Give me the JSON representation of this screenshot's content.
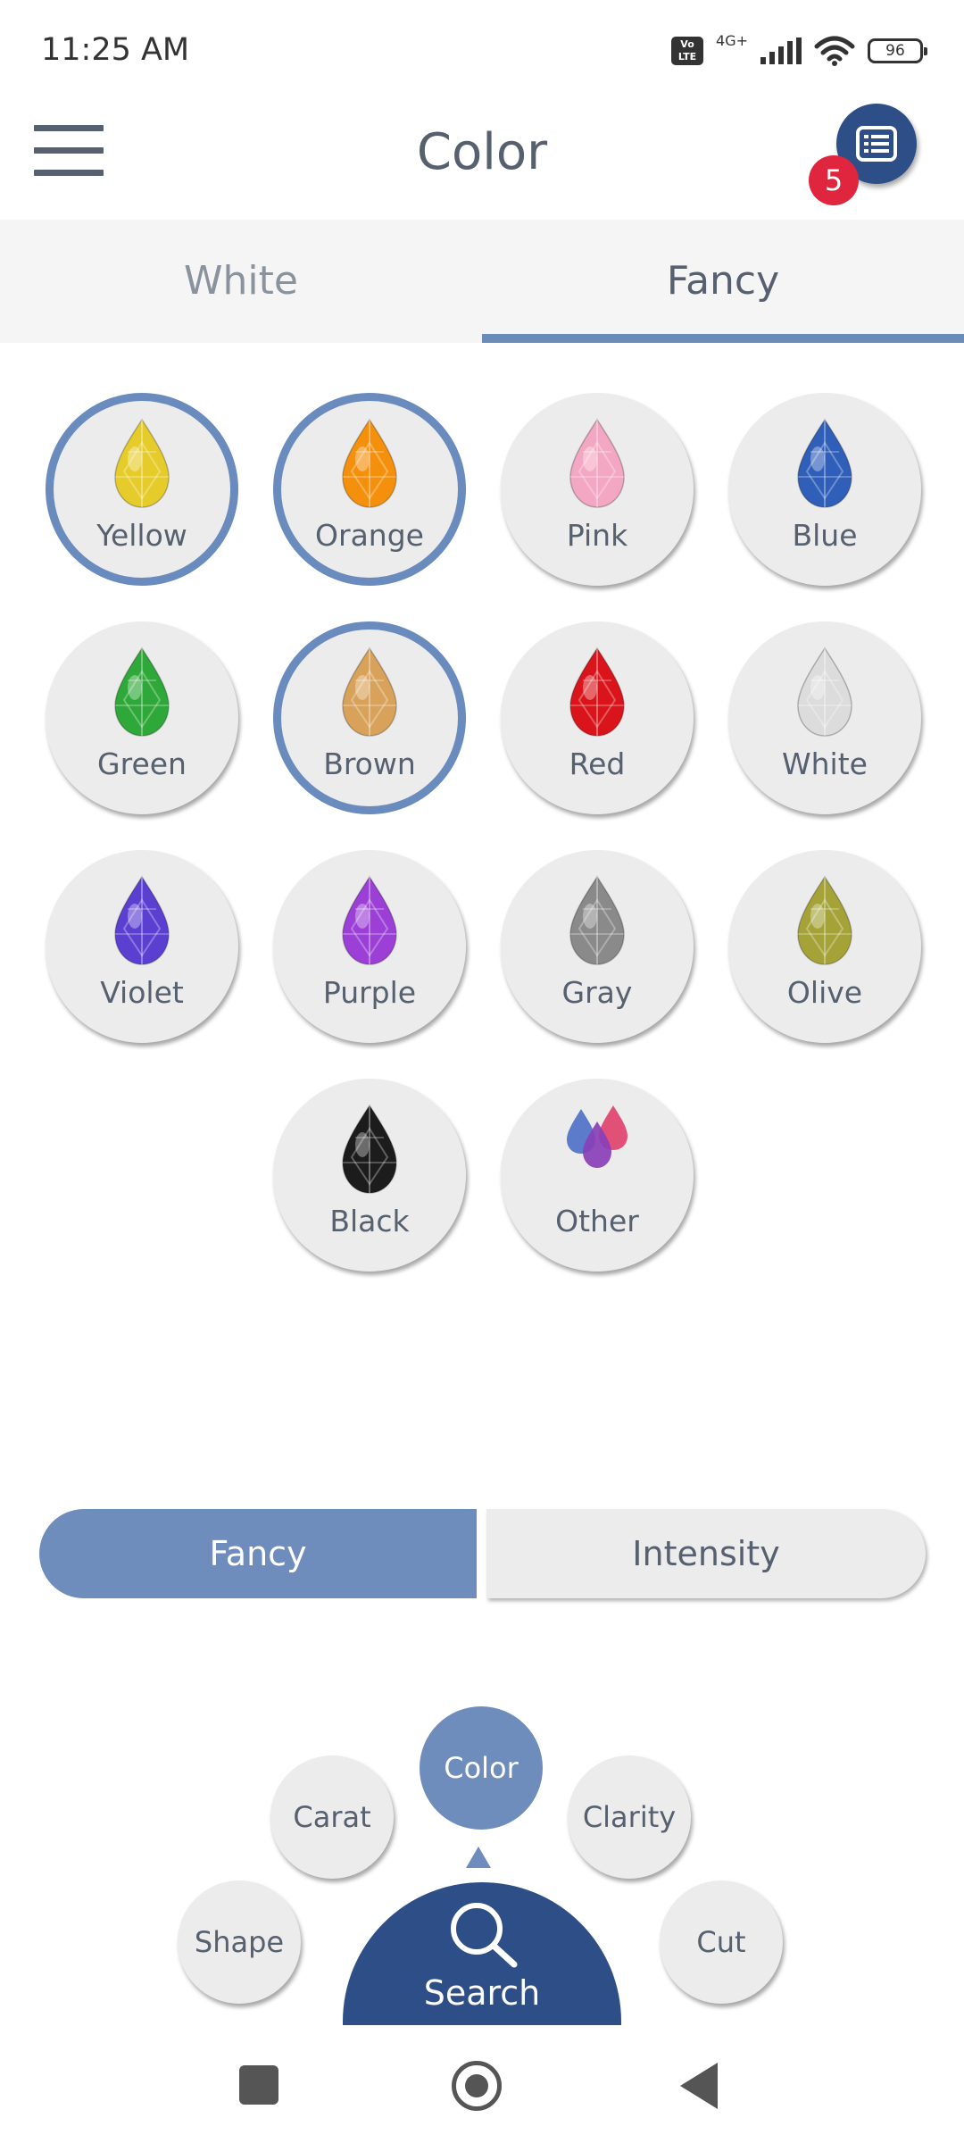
{
  "status": {
    "time": "11:25 AM",
    "volte": "Vo LTE",
    "network": "4G+",
    "battery": "96"
  },
  "header": {
    "title": "Color",
    "badge_count": "5"
  },
  "tabs": [
    {
      "label": "White",
      "active": false
    },
    {
      "label": "Fancy",
      "active": true
    }
  ],
  "colors": [
    {
      "label": "Yellow",
      "gem": "#e6cc2a",
      "selected": true
    },
    {
      "label": "Orange",
      "gem": "#f5900d",
      "selected": true
    },
    {
      "label": "Pink",
      "gem": "#f4a7c2",
      "selected": false
    },
    {
      "label": "Blue",
      "gem": "#2f5fb8",
      "selected": false
    },
    {
      "label": "Green",
      "gem": "#2ea838",
      "selected": false
    },
    {
      "label": "Brown",
      "gem": "#d9a25a",
      "selected": true
    },
    {
      "label": "Red",
      "gem": "#d9141a",
      "selected": false
    },
    {
      "label": "White",
      "gem": "#dcdcdc",
      "selected": false
    },
    {
      "label": "Violet",
      "gem": "#5a3fd1",
      "selected": false
    },
    {
      "label": "Purple",
      "gem": "#9b3fd6",
      "selected": false
    },
    {
      "label": "Gray",
      "gem": "#8a8a8a",
      "selected": false
    },
    {
      "label": "Olive",
      "gem": "#a5a338",
      "selected": false
    },
    {
      "label": "Black",
      "gem": "#1c1c1c",
      "selected": false
    },
    {
      "label": "Other",
      "gem": "multi",
      "selected": false
    }
  ],
  "segment": {
    "left": "Fancy",
    "right": "Intensity",
    "active": "left"
  },
  "steps": {
    "shape": "Shape",
    "carat": "Carat",
    "color": "Color",
    "clarity": "Clarity",
    "cut": "Cut",
    "active": "color"
  },
  "search_label": "Search"
}
